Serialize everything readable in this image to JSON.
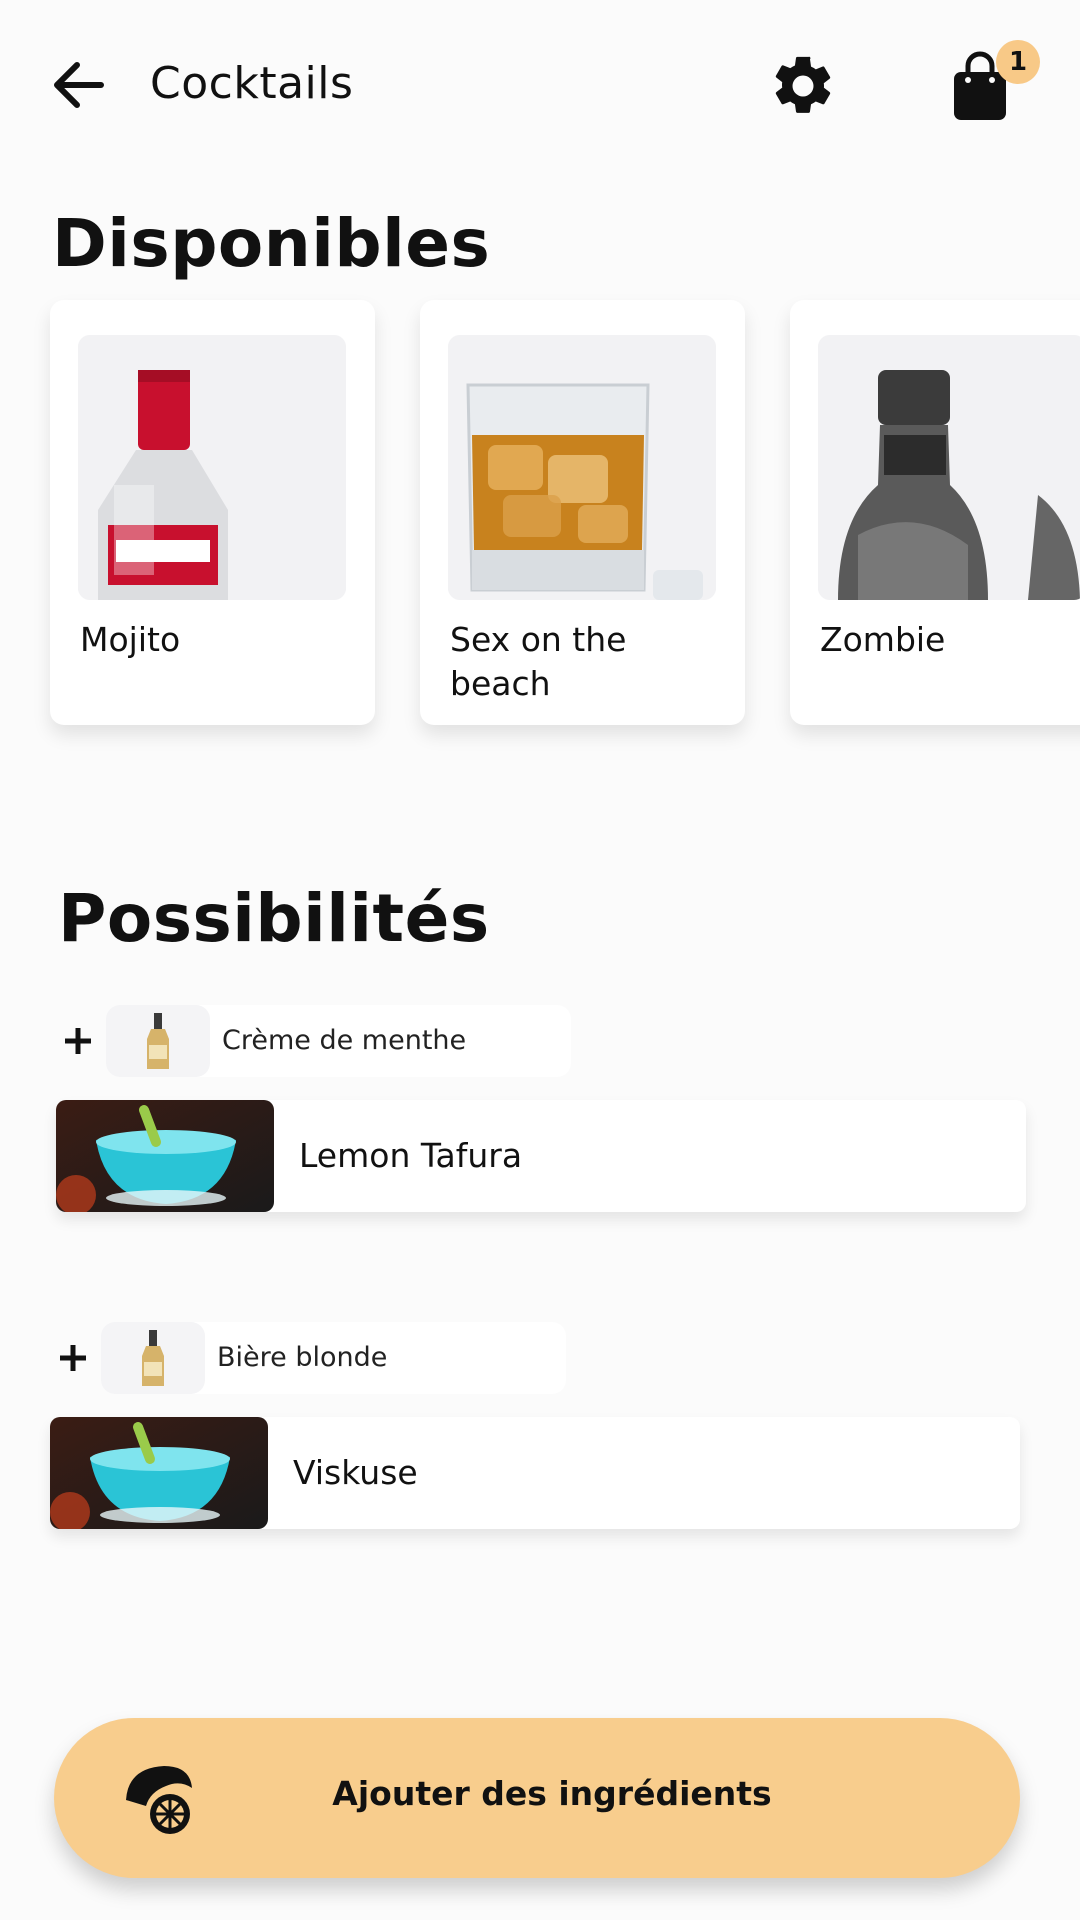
{
  "header": {
    "title": "Cocktails",
    "cart_count": "1",
    "icons": {
      "back": "arrow-left-icon",
      "settings": "gear-icon",
      "cart": "shopping-bag-icon"
    }
  },
  "sections": {
    "available_title": "Disponibles",
    "possibilities_title": "Possibilités"
  },
  "available": [
    {
      "name": "Mojito",
      "image": "vodka-bottle"
    },
    {
      "name": "Sex on the beach",
      "image": "whisky-glass"
    },
    {
      "name": "Zombie",
      "image": "dark-bottle"
    }
  ],
  "possibilities": [
    {
      "ingredient": "Crème de menthe",
      "cocktail": "Lemon Tafura"
    },
    {
      "ingredient": "Bière blonde",
      "cocktail": "Viskuse"
    }
  ],
  "cta": {
    "label": "Ajouter des ingrédients",
    "icon": "lemon-squeezer-icon"
  },
  "colors": {
    "accent": "#f8cd8d",
    "badge": "#f8c987",
    "background": "#fbfbfb"
  }
}
